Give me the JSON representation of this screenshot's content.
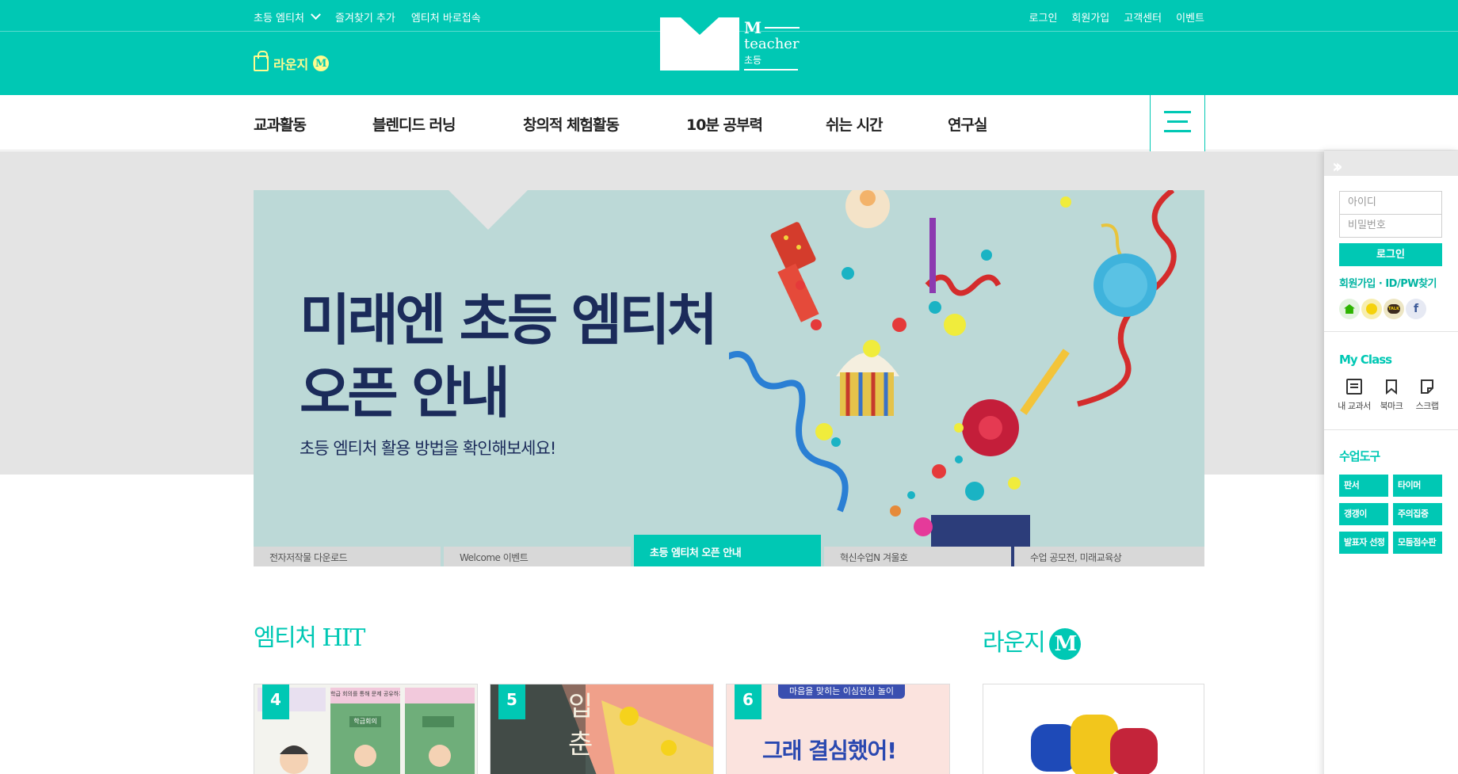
{
  "util": {
    "elementary": "초등 엠티처",
    "bookmark": "즐겨찾기 추가",
    "shortcut": "엠티처 바로접속",
    "login": "로그인",
    "join": "회원가입",
    "support": "고객센터",
    "event": "이벤트"
  },
  "lounge_top": {
    "label": "라운지",
    "badge": "M"
  },
  "logo": {
    "m": "M",
    "teacher": "teacher",
    "level": "초등"
  },
  "nav": [
    "교과활동",
    "블렌디드 러닝",
    "창의적 체험활동",
    "10분 공부력",
    "쉬는 시간",
    "연구실"
  ],
  "banner": {
    "title_line1": "미래엔 초등 엠티처",
    "title_line2": "오픈 안내",
    "subtitle": "초등 엠티처 활용 방법을 확인해보세요!"
  },
  "tabs": [
    "전자저작물 다운로드",
    "Welcome 이벤트",
    "초등 엠티처 오픈 안내",
    "혁신수업N 겨울호",
    "수업 공모전, 미래교육상"
  ],
  "hit": {
    "title": "엠티처 HIT",
    "cards": [
      {
        "rank": "4",
        "heading": "학급회의",
        "strip": "학급 회의를 통해 문제 공유하기"
      },
      {
        "rank": "5",
        "heading": "입춘",
        "strip": ""
      },
      {
        "rank": "6",
        "heading": "그래 결심했어!",
        "strip": "마음을 맞히는 이심전심 놀이"
      }
    ]
  },
  "lounge": {
    "title": "라운지",
    "badge": "M"
  },
  "quick": {
    "id_placeholder": "아이디",
    "pw_placeholder": "비밀번호",
    "login": "로그인",
    "join_find": "회원가입 · ID/PW찾기",
    "sns": [
      "naver-icon",
      "kakao-icon",
      "kakaotalk-icon",
      "facebook-icon"
    ],
    "sns_labels": [
      "",
      "",
      "TALK",
      "f"
    ],
    "myclass_title": "My Class",
    "myclass": [
      "내 교과서",
      "북마크",
      "스크랩"
    ],
    "tools_title": "수업도구",
    "tools": [
      "판서",
      "타이머",
      "갱갱이",
      "주의집중",
      "발표자 선정",
      "모둠점수판"
    ]
  },
  "colors": {
    "brand": "#00c8b4",
    "navy": "#1b2b5a",
    "highlight": "#fffb8f"
  }
}
